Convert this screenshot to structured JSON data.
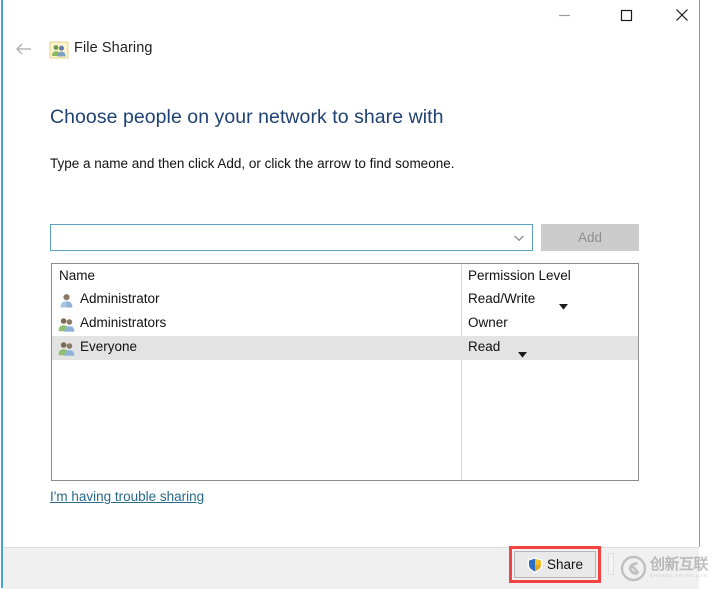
{
  "window": {
    "app_title": "File Sharing",
    "app_icon": "file-sharing-people-icon",
    "back_arrow_icon": "back-arrow-icon",
    "controls": {
      "minimize": "minimize-icon",
      "maximize": "maximize-icon",
      "close": "close-icon"
    }
  },
  "main": {
    "heading": "Choose people on your network to share with",
    "instruction": "Type a name and then click Add, or click the arrow to find someone.",
    "accent_heading_color": "#1f4173"
  },
  "combo": {
    "value": "",
    "placeholder": "",
    "arrow_icon": "chevron-down-icon",
    "border_color": "#5ba3bd"
  },
  "add_button": {
    "label": "Add",
    "disabled": true,
    "background": "#cccccc",
    "text_color": "#8f8f8f"
  },
  "list": {
    "columns": [
      "Name",
      "Permission Level"
    ],
    "rows": [
      {
        "name": "Administrator",
        "permission": "Read/Write",
        "icon": "single-user-icon",
        "has_dropdown": true,
        "selected": false
      },
      {
        "name": "Administrators",
        "permission": "Owner",
        "icon": "user-group-icon",
        "has_dropdown": false,
        "selected": false
      },
      {
        "name": "Everyone",
        "permission": "Read",
        "icon": "user-group-icon",
        "has_dropdown": true,
        "selected": true
      }
    ],
    "selected_row_color": "#e3e3e3"
  },
  "trouble_link": {
    "label": "I'm having trouble sharing",
    "color": "#2a6a8a"
  },
  "footer": {
    "share_label": "Share",
    "share_icon": "uac-shield-icon",
    "highlight_color": "#f24242",
    "background": "#f0f0f0"
  },
  "watermark": {
    "text": "创新互联",
    "subtext": "CHUANG XIN HU LIAN",
    "logo": "cx-circle-logo"
  }
}
